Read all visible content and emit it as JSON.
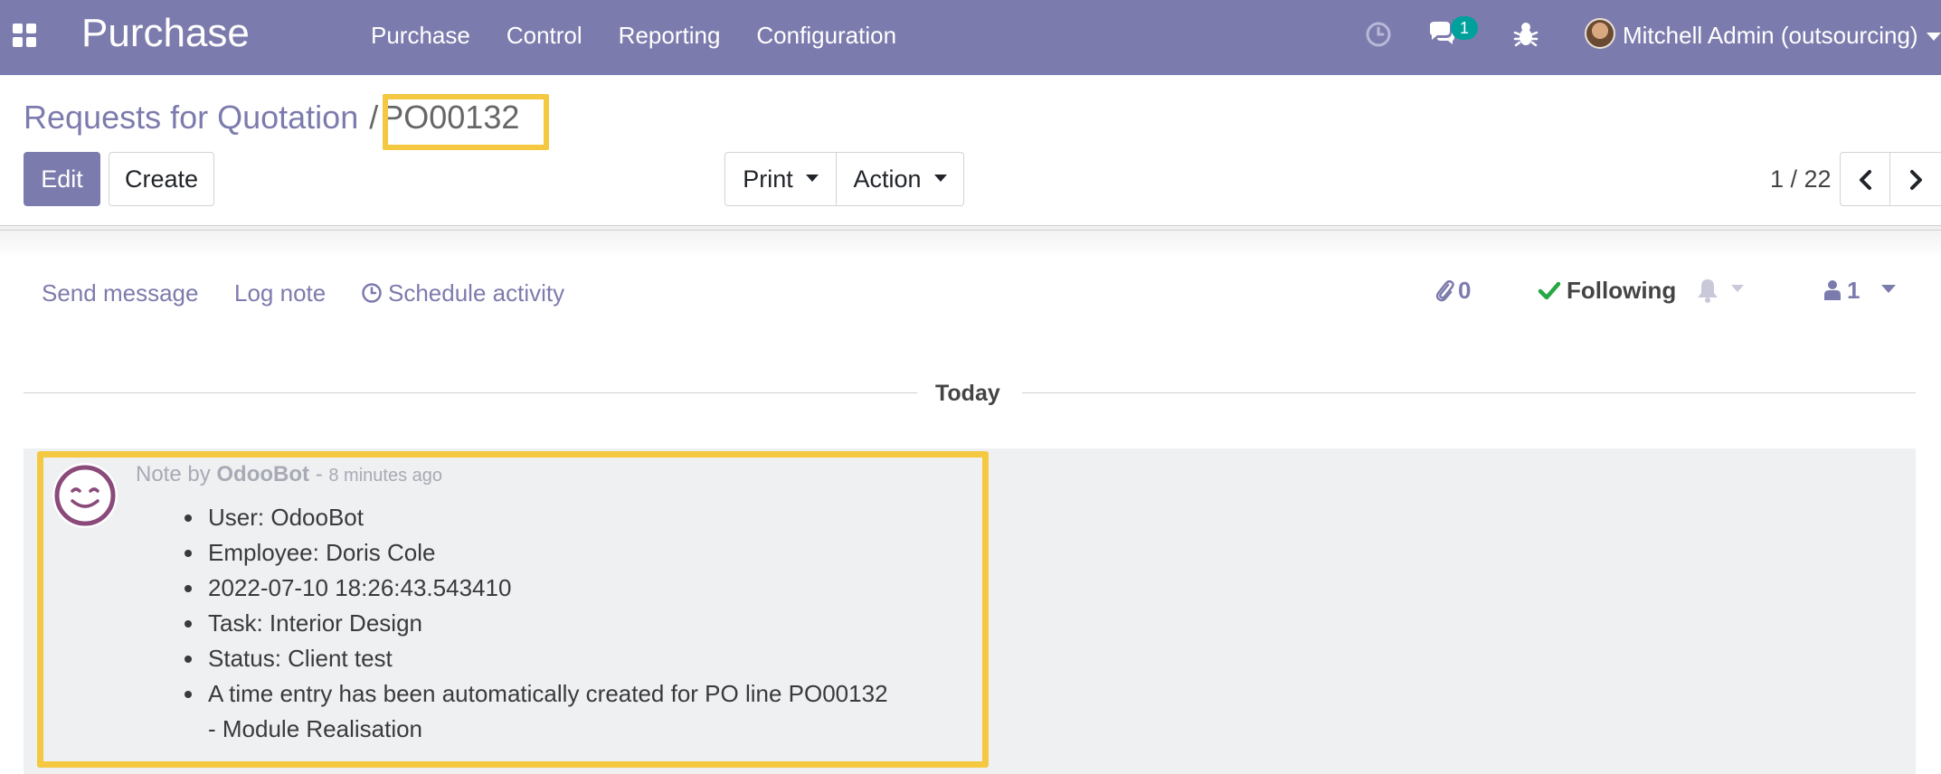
{
  "navbar": {
    "brand": "Purchase",
    "menu": [
      "Purchase",
      "Control",
      "Reporting",
      "Configuration"
    ],
    "chat_badge": "1",
    "user_name": "Mitchell Admin (outsourcing)",
    "icons": [
      "apps-icon",
      "clock-icon",
      "chat-icon",
      "bug-icon",
      "user-avatar"
    ],
    "bg_color": "#7c7bad"
  },
  "breadcrumb": {
    "parent": "Requests for Quotation",
    "separator": "/",
    "current": "PO00132"
  },
  "toolbar": {
    "edit_label": "Edit",
    "create_label": "Create",
    "print_label": "Print",
    "action_label": "Action"
  },
  "pager": {
    "value": "1 / 22"
  },
  "chatter": {
    "send_message": "Send message",
    "log_note": "Log note",
    "schedule_activity": "Schedule activity",
    "attachments_count": "0",
    "following_label": "Following",
    "followers_count": "1",
    "date_separator": "Today"
  },
  "message": {
    "type_label": "Note by",
    "author": "OdooBot",
    "dash": "-",
    "time_ago": "8 minutes ago",
    "lines": [
      "User: OdooBot",
      "Employee: Doris Cole",
      "2022-07-10 18:26:43.543410",
      "Task: Interior Design",
      "Status: Client test"
    ],
    "last_line_1": "A time entry has been automatically created for PO line PO00132",
    "last_line_2": "- Module Realisation"
  },
  "colors": {
    "highlight": "#f5c842",
    "accent": "#7c7bad",
    "success": "#28a745"
  }
}
